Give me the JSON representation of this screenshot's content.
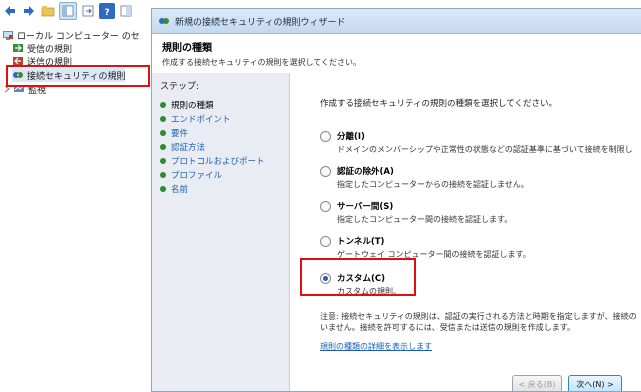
{
  "left_pane": {
    "tree": [
      {
        "label": "ローカル コンピューター のセ",
        "icon": "computer-firewall-icon"
      },
      {
        "label": "受信の規則",
        "icon": "inbound-rules-icon"
      },
      {
        "label": "送信の規則",
        "icon": "outbound-rules-icon"
      },
      {
        "label": "接続セキュリティの規則",
        "icon": "connection-security-icon",
        "selected": true
      },
      {
        "label": "監視",
        "icon": "monitoring-icon"
      }
    ]
  },
  "wizard": {
    "title": "新規の接続セキュリティの規則ウィザード",
    "heading": "規則の種類",
    "subheading": "作成する接続セキュリティの規則を選択してください。",
    "steps_title": "ステップ:",
    "steps": [
      {
        "label": "規則の種類",
        "current": true
      },
      {
        "label": "エンドポイント"
      },
      {
        "label": "要件"
      },
      {
        "label": "認証方法"
      },
      {
        "label": "プロトコルおよびポート"
      },
      {
        "label": "プロファイル"
      },
      {
        "label": "名前"
      }
    ],
    "prompt": "作成する接続セキュリティの規則の種類を選択してください。",
    "options": [
      {
        "title": "分離(I)",
        "desc": "ドメインのメンバーシップや正常性の状態などの認証基準に基づいて接続を制限し",
        "selected": false
      },
      {
        "title": "認証の除外(A)",
        "desc": "指定したコンピューターからの接続を認証しません。",
        "selected": false
      },
      {
        "title": "サーバー間(S)",
        "desc": "指定したコンピューター間の接続を認証します。",
        "selected": false
      },
      {
        "title": "トンネル(T)",
        "desc": "ゲートウェイ コンピューター間の接続を認証します。",
        "selected": false
      },
      {
        "title": "カスタム(C)",
        "desc": "カスタムの規則。",
        "selected": true
      }
    ],
    "note_line1": "注意: 接続セキュリティの規則は、認証の実行される方法と時期を指定しますが、接続の",
    "note_line2": "いません。接続を許可するには、受信または送信の規則を作成します。",
    "link": "規則の種類の詳細を表示します",
    "back_button": "< 戻る(B)",
    "next_button": "次へ(N) >"
  },
  "colors": {
    "highlight": "#e01010",
    "link": "#1a5fb4",
    "step_dot": "#2e8b2e"
  }
}
